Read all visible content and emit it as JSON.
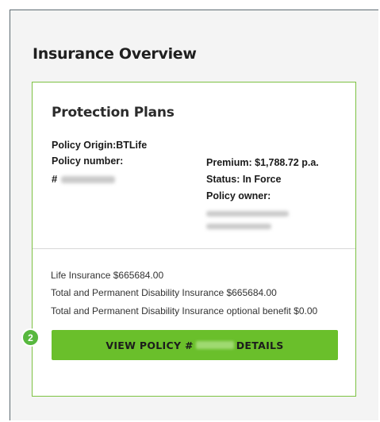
{
  "section": {
    "title": "Insurance Overview"
  },
  "card": {
    "title": "Protection Plans",
    "policy_origin_label": "Policy Origin:BTLife",
    "policy_number_label": "Policy number:",
    "policy_number_hash": "#",
    "premium": "Premium: $1,788.72 p.a.",
    "status": "Status: In Force",
    "policy_owner_label": "Policy owner:",
    "benefits": [
      "Life Insurance $665684.00",
      "Total and Permanent Disability Insurance $665684.00",
      "Total and Permanent Disability Insurance optional benefit $0.00"
    ],
    "view_button": {
      "prefix": "VIEW POLICY #",
      "suffix": "DETAILS"
    }
  },
  "step_badge": "2",
  "colors": {
    "accent_green": "#6abf2b",
    "card_border": "#7dc242",
    "badge": "#57b83e",
    "panel_bg": "#f4f4f4"
  }
}
